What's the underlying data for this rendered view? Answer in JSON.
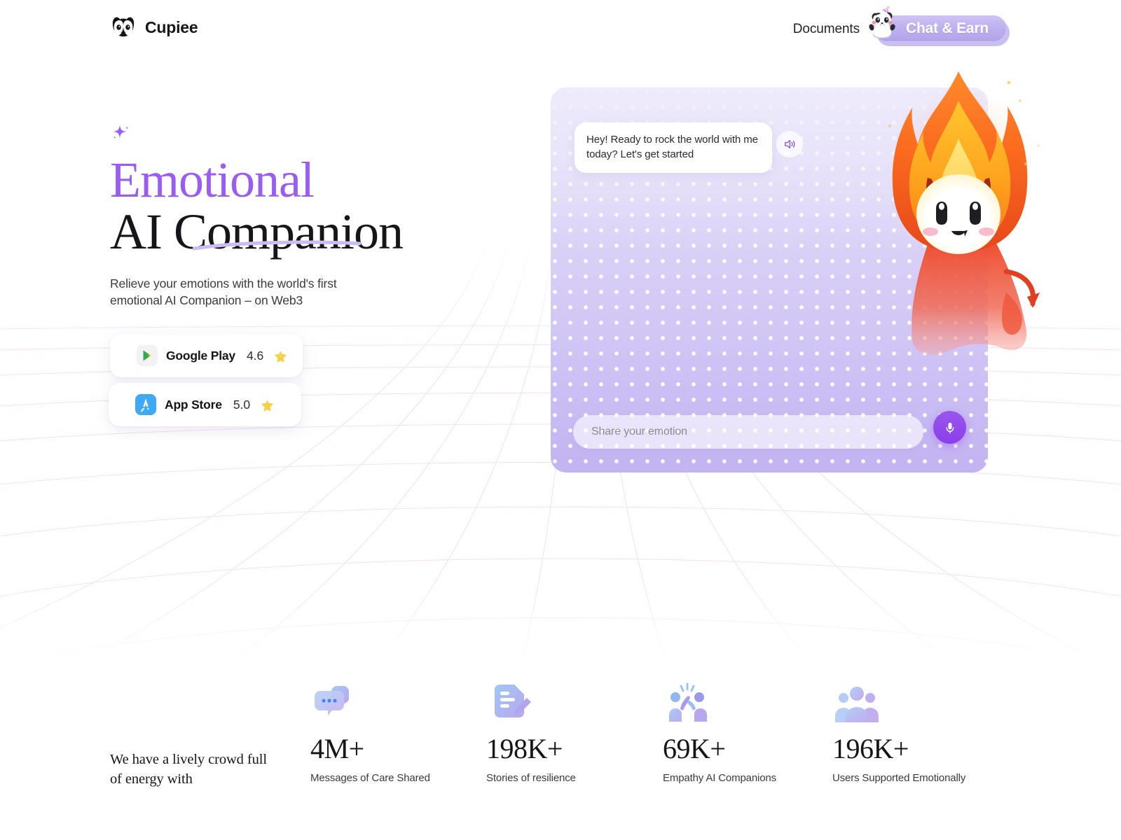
{
  "brand": {
    "name": "Cupiee",
    "logo_icon": "panda-logo-icon"
  },
  "nav": {
    "documents_label": "Documents",
    "cta_label": "Chat & Earn",
    "cta_mascot_icon": "panda-party-mascot-icon"
  },
  "hero": {
    "sparkle_icon": "sparkle-icon",
    "title_line1": "Emotional",
    "title_line2": "AI Companion",
    "subtitle": "Relieve your emotions with the world's first emotional AI Companion  – on Web3",
    "accent_color": "#9a5cf2",
    "stores": [
      {
        "name": "Google Play",
        "rating": "4.6",
        "icon": "google-play-icon",
        "star_icon": "star-icon"
      },
      {
        "name": "App Store",
        "rating": "5.0",
        "icon": "app-store-icon",
        "star_icon": "star-icon"
      }
    ]
  },
  "chat": {
    "message": "Hey! Ready to rock the world with me today? Let's get started",
    "speaker_icon": "speaker-icon",
    "input_placeholder": "Share your emotion",
    "input_value": "",
    "mic_icon": "microphone-icon",
    "mascot_icon": "flame-devil-mascot-icon",
    "panel_color": "#cdbff4"
  },
  "stats": {
    "tagline": "We have a lively crowd full of energy with",
    "items": [
      {
        "value": "4M+",
        "label": "Messages of Care Shared",
        "icon": "chat-bubbles-icon"
      },
      {
        "value": "198K+",
        "label": "Stories of resilience",
        "icon": "document-edit-icon"
      },
      {
        "value": "69K+",
        "label": "Empathy AI Companions",
        "icon": "high-five-people-icon"
      },
      {
        "value": "196K+",
        "label": "Users Supported Emotionally",
        "icon": "group-users-icon"
      }
    ]
  }
}
